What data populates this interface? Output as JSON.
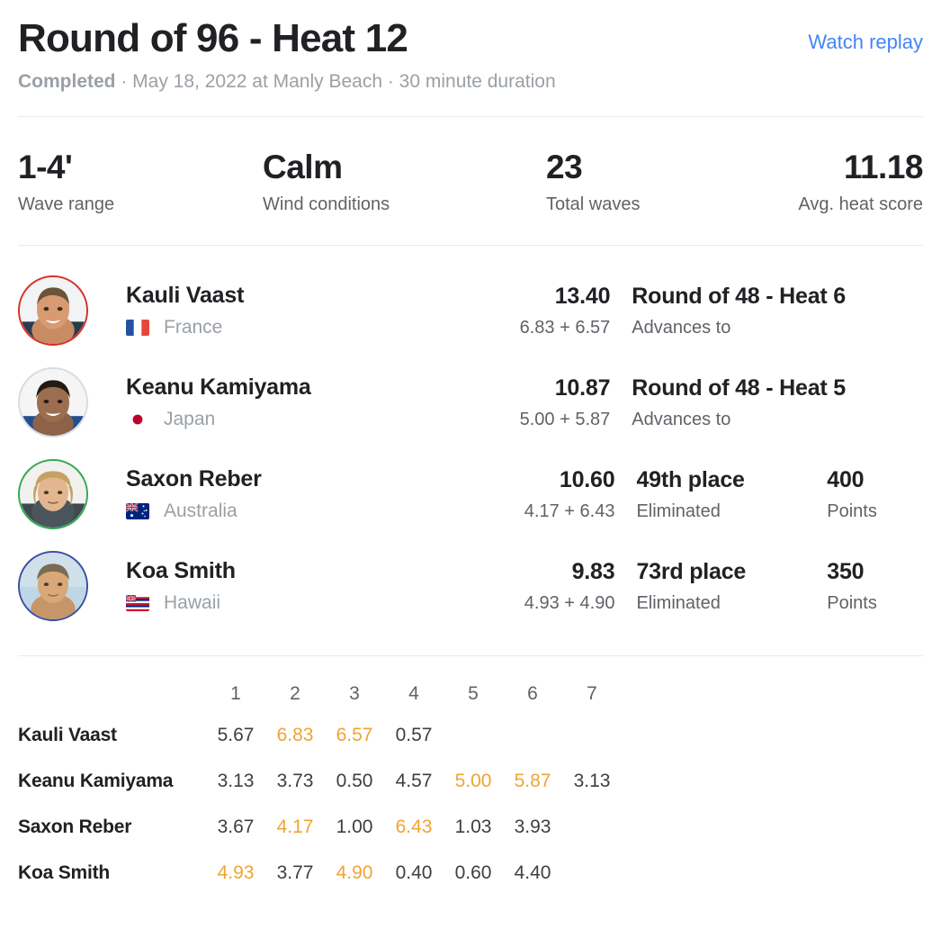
{
  "header": {
    "title": "Round of 96 - Heat 12",
    "watch_replay_label": "Watch replay",
    "status": "Completed",
    "subtitle_rest": " · May 18, 2022 at Manly Beach · 30 minute duration"
  },
  "stats": [
    {
      "value": "1-4'",
      "label": "Wave range"
    },
    {
      "value": "Calm",
      "label": "Wind conditions"
    },
    {
      "value": "23",
      "label": "Total waves"
    },
    {
      "value": "11.18",
      "label": "Avg. heat score"
    }
  ],
  "athletes": [
    {
      "name": "Kauli Vaast",
      "country": "France",
      "flag": "flag-france",
      "ring_color": "#d93025",
      "total": "13.40",
      "breakdown": "6.83 + 6.57",
      "result_main": "Round of 48 - Heat 6",
      "result_sub": "Advances to",
      "points_value": "",
      "points_label": "",
      "has_points": false
    },
    {
      "name": "Keanu Kamiyama",
      "country": "Japan",
      "flag": "flag-japan",
      "ring_color": "#dadce0",
      "total": "10.87",
      "breakdown": "5.00 + 5.87",
      "result_main": "Round of 48 - Heat 5",
      "result_sub": "Advances to",
      "points_value": "",
      "points_label": "",
      "has_points": false
    },
    {
      "name": "Saxon Reber",
      "country": "Australia",
      "flag": "flag-australia",
      "ring_color": "#34a853",
      "total": "10.60",
      "breakdown": "4.17 + 6.43",
      "result_main": "49th place",
      "result_sub": "Eliminated",
      "points_value": "400",
      "points_label": "Points",
      "has_points": true
    },
    {
      "name": "Koa Smith",
      "country": "Hawaii",
      "flag": "flag-hawaii",
      "ring_color": "#3b4fa0",
      "total": "9.83",
      "breakdown": "4.93 + 4.90",
      "result_main": "73rd place",
      "result_sub": "Eliminated",
      "points_value": "350",
      "points_label": "Points",
      "has_points": true
    }
  ],
  "wave_table": {
    "columns": [
      "1",
      "2",
      "3",
      "4",
      "5",
      "6",
      "7"
    ],
    "rows": [
      {
        "athlete": "Kauli Vaast",
        "scores": [
          "5.67",
          "6.83",
          "6.57",
          "0.57",
          "",
          "",
          ""
        ],
        "best": [
          false,
          true,
          true,
          false,
          false,
          false,
          false
        ]
      },
      {
        "athlete": "Keanu Kamiyama",
        "scores": [
          "3.13",
          "3.73",
          "0.50",
          "4.57",
          "5.00",
          "5.87",
          "3.13"
        ],
        "best": [
          false,
          false,
          false,
          false,
          true,
          true,
          false
        ]
      },
      {
        "athlete": "Saxon Reber",
        "scores": [
          "3.67",
          "4.17",
          "1.00",
          "6.43",
          "1.03",
          "3.93",
          ""
        ],
        "best": [
          false,
          true,
          false,
          true,
          false,
          false,
          false
        ]
      },
      {
        "athlete": "Koa Smith",
        "scores": [
          "4.93",
          "3.77",
          "4.90",
          "0.40",
          "0.60",
          "4.40",
          ""
        ],
        "best": [
          true,
          false,
          true,
          false,
          false,
          false,
          false
        ]
      }
    ]
  },
  "colors": {
    "link": "#4285f4",
    "best_score": "#f0a431",
    "text_primary": "#202124",
    "text_muted": "#5f6368",
    "text_light": "#9aa0a6",
    "divider": "#e8eaed"
  }
}
